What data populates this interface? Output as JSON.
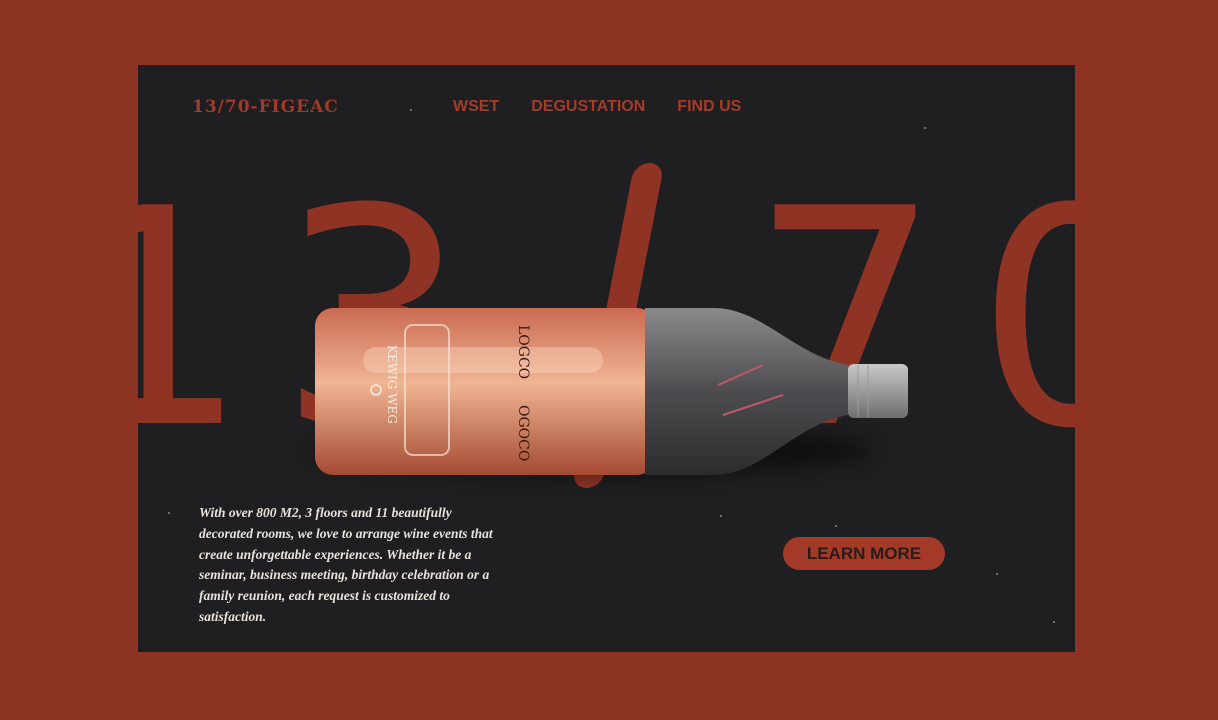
{
  "header": {
    "logo": "13/70-FIGEAC",
    "nav": [
      "WSET",
      "DEGUSTATION",
      "FIND US"
    ]
  },
  "hero": {
    "digits": [
      "1",
      "3",
      "7",
      "0"
    ],
    "description": "With over 800 M2, 3 floors and 11 beautifully decorated rooms,  we love to arrange wine events that create unforgettable experiences. Whether it be a seminar, business meeting, birthday celebration  or a family reunion, each request is customized to satisfaction.",
    "cta_label": "LEARN MORE"
  },
  "colors": {
    "background": "#8d3324",
    "panel": "#1f1e20",
    "accent": "#a33a28"
  }
}
